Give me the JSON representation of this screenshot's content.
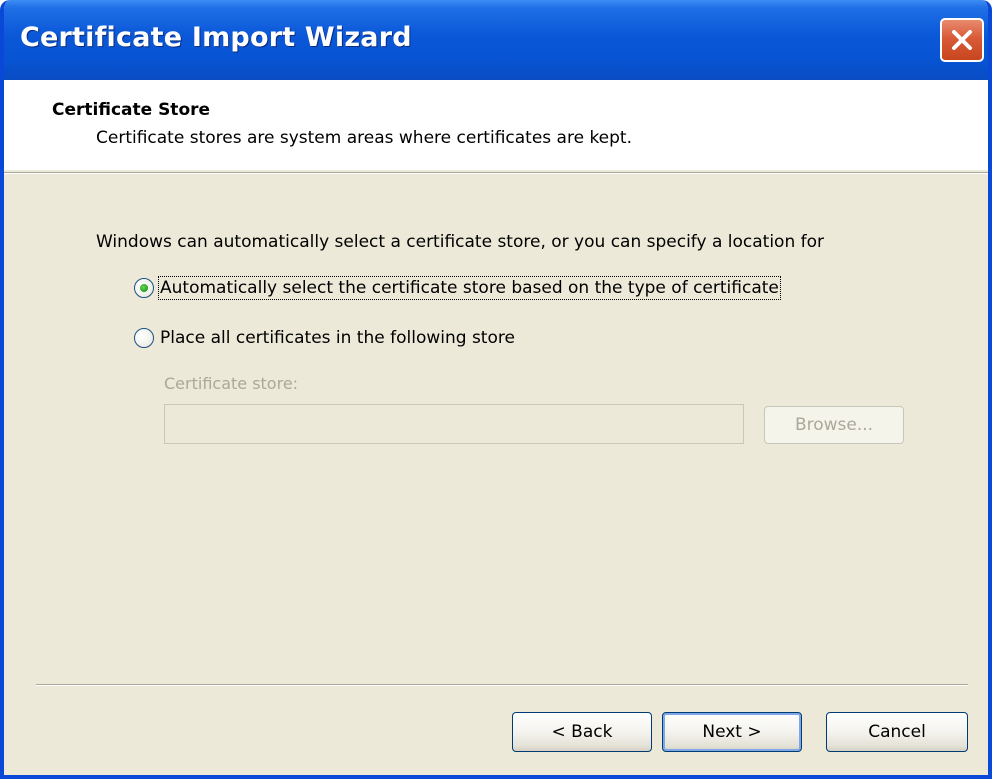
{
  "window": {
    "title": "Certificate Import Wizard",
    "close_icon": "close-icon"
  },
  "header": {
    "title": "Certificate Store",
    "description": "Certificate stores are system areas where certificates are kept."
  },
  "body": {
    "intro": "Windows can automatically select a certificate store, or you can specify a location for",
    "options": [
      {
        "label": "Automatically select the certificate store based on the type of certificate",
        "selected": true
      },
      {
        "label": "Place all certificates in the following store",
        "selected": false
      }
    ],
    "store_label": "Certificate store:",
    "store_value": "",
    "browse_label": "Browse..."
  },
  "footer": {
    "back_label": "< Back",
    "next_label": "Next >",
    "cancel_label": "Cancel"
  },
  "colors": {
    "titlebar": "#0a57d8",
    "close_button": "#d95a38",
    "radio_selected": "#22a01c",
    "dialog_background": "#ece9d8"
  }
}
